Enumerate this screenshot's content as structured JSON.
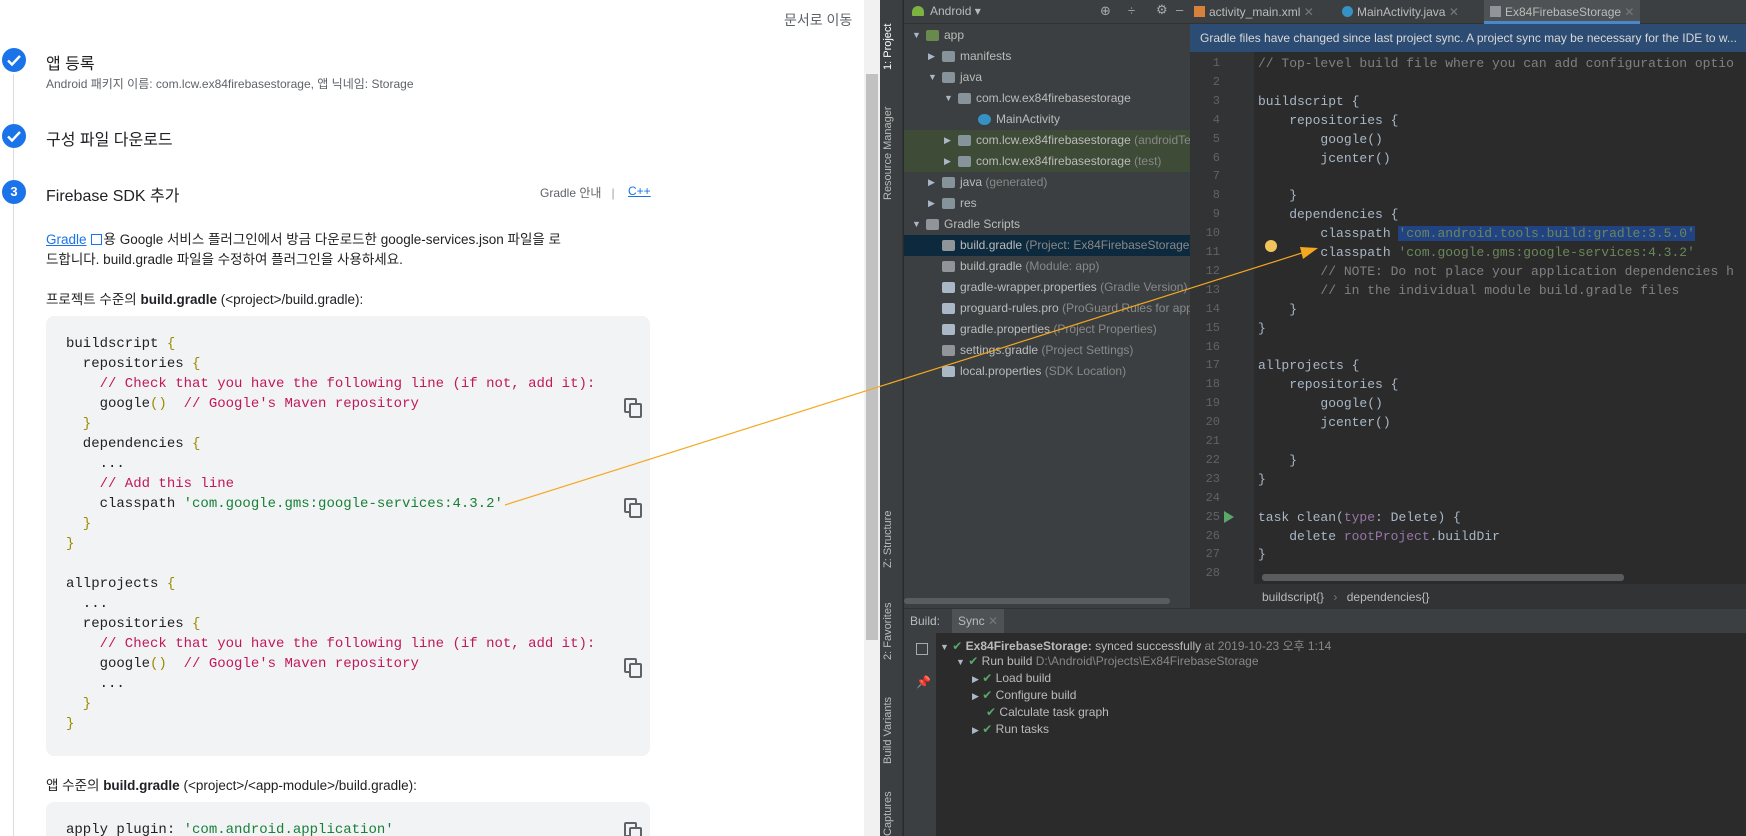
{
  "left": {
    "doc_link": "문서로 이동",
    "steps": [
      {
        "num": "",
        "title": "앱 등록",
        "subtitle": "Android 패키지 이름: com.lcw.ex84firebasestorage, 앱 닉네임: Storage"
      },
      {
        "num": "",
        "title": "구성 파일 다운로드",
        "subtitle": ""
      },
      {
        "num": "3",
        "title": "Firebase SDK 추가",
        "subtitle": ""
      }
    ],
    "gradle_guide": "Gradle 안내",
    "separator": "|",
    "cpp": "C++",
    "intro_link": "Gradle",
    "intro_text1": "용 Google 서비스 플러그인에서 방금 다운로드한 google-services.json 파일을 로",
    "intro_text2": "드합니다. build.gradle 파일을 수정하여 플러그인을 사용하세요.",
    "project_level_prefix": "프로젝트 수준의 ",
    "project_level_bold": "build.gradle",
    "project_level_suffix": " (<project>/build.gradle):",
    "app_level_prefix": "앱 수준의 ",
    "app_level_bold": "build.gradle",
    "app_level_suffix": " (<project>/<app-module>/build.gradle):",
    "code1": {
      "l1a": "buildscript ",
      "l1b": "{",
      "l2a": "  repositories ",
      "l2b": "{",
      "l3": "    // Check that you have the following line (if not, add it):",
      "l4a": "    google",
      "l4b": "()",
      "l4c": "  // Google's Maven repository",
      "l5": "  }",
      "l6a": "  dependencies ",
      "l6b": "{",
      "l7": "    ...",
      "l8": "    // Add this line",
      "l9a": "    classpath ",
      "l9b": "'com.google.gms:google-services:4.3.2'",
      "l10": "  }",
      "l11": "}",
      "l12a": "allprojects ",
      "l12b": "{",
      "l13": "  ...",
      "l14a": "  repositories ",
      "l14b": "{",
      "l15": "    // Check that you have the following line (if not, add it):",
      "l16a": "    google",
      "l16b": "()",
      "l16c": "  // Google's Maven repository",
      "l17": "    ...",
      "l18": "  }",
      "l19": "}"
    },
    "code2": {
      "l1a": "apply plugin: ",
      "l1b": "'com.android.application'"
    }
  },
  "ide": {
    "toolstrip": {
      "project": "1: Project",
      "resource_manager": "Resource Manager",
      "structure": "Z: Structure",
      "favorites": "2: Favorites",
      "build_variants": "Build Variants",
      "captures": "Captures"
    },
    "project_view": "Android",
    "tree": [
      {
        "label": "app",
        "sub": ""
      },
      {
        "label": "manifests",
        "sub": ""
      },
      {
        "label": "java",
        "sub": ""
      },
      {
        "label": "com.lcw.ex84firebasestorage",
        "sub": ""
      },
      {
        "label": "MainActivity",
        "sub": ""
      },
      {
        "label": "com.lcw.ex84firebasestorage",
        "sub": "(androidTest)"
      },
      {
        "label": "com.lcw.ex84firebasestorage",
        "sub": "(test)"
      },
      {
        "label": "java",
        "sub": "(generated)"
      },
      {
        "label": "res",
        "sub": ""
      },
      {
        "label": "Gradle Scripts",
        "sub": ""
      },
      {
        "label": "build.gradle",
        "sub": "(Project: Ex84FirebaseStorage)"
      },
      {
        "label": "build.gradle",
        "sub": "(Module: app)"
      },
      {
        "label": "gradle-wrapper.properties",
        "sub": "(Gradle Version)"
      },
      {
        "label": "proguard-rules.pro",
        "sub": "(ProGuard Rules for app)"
      },
      {
        "label": "gradle.properties",
        "sub": "(Project Properties)"
      },
      {
        "label": "settings.gradle",
        "sub": "(Project Settings)"
      },
      {
        "label": "local.properties",
        "sub": "(SDK Location)"
      }
    ],
    "tabs": [
      "activity_main.xml",
      "MainActivity.java",
      "Ex84FirebaseStorage"
    ],
    "notice": "Gradle files have changed since last project sync. A project sync may be necessary for the IDE to w...",
    "code": [
      {
        "n": "1",
        "t": "// Top-level build file where you can add configuration optio"
      },
      {
        "n": "2",
        "t": ""
      },
      {
        "n": "3",
        "t": "buildscript {"
      },
      {
        "n": "4",
        "t": "    repositories {"
      },
      {
        "n": "5",
        "t": "        google()"
      },
      {
        "n": "6",
        "t": "        jcenter()"
      },
      {
        "n": "7",
        "t": ""
      },
      {
        "n": "8",
        "t": "    }"
      },
      {
        "n": "9",
        "t": "    dependencies {"
      },
      {
        "n": "10",
        "t": "        classpath ",
        "s": "'com.android.tools.build:gradle:3.5.0'"
      },
      {
        "n": "11",
        "t": "        classpath ",
        "s": "'com.google.gms:google-services:4.3.2'"
      },
      {
        "n": "12",
        "t": "        // NOTE: Do not place your application dependencies h"
      },
      {
        "n": "13",
        "t": "        // in the individual module build.gradle files"
      },
      {
        "n": "14",
        "t": "    }"
      },
      {
        "n": "15",
        "t": "}"
      },
      {
        "n": "16",
        "t": ""
      },
      {
        "n": "17",
        "t": "allprojects {"
      },
      {
        "n": "18",
        "t": "    repositories {"
      },
      {
        "n": "19",
        "t": "        google()"
      },
      {
        "n": "20",
        "t": "        jcenter()"
      },
      {
        "n": "21",
        "t": ""
      },
      {
        "n": "22",
        "t": "    }"
      },
      {
        "n": "23",
        "t": "}"
      },
      {
        "n": "24",
        "t": ""
      },
      {
        "n": "25",
        "t": "task clean(",
        "p": "type",
        "t2": ": Delete) {"
      },
      {
        "n": "26",
        "t": "    delete ",
        "p": "rootProject",
        "t2": ".buildDir"
      },
      {
        "n": "27",
        "t": "}"
      },
      {
        "n": "28",
        "t": ""
      }
    ],
    "breadcrumb": [
      "buildscript{}",
      "dependencies{}"
    ],
    "build": {
      "tab_build": "Build:",
      "tab_sync": "Sync",
      "rows": [
        {
          "bold": "Ex84FirebaseStorage:",
          "text": " synced successfully",
          "dim": " at 2019-10-23 오후 1:14"
        },
        {
          "bold": "",
          "text": "Run build",
          "dim": " D:\\Android\\Projects\\Ex84FirebaseStorage"
        },
        {
          "bold": "",
          "text": "Load build",
          "dim": ""
        },
        {
          "bold": "",
          "text": "Configure build",
          "dim": ""
        },
        {
          "bold": "",
          "text": "Calculate task graph",
          "dim": ""
        },
        {
          "bold": "",
          "text": "Run tasks",
          "dim": ""
        }
      ]
    }
  }
}
